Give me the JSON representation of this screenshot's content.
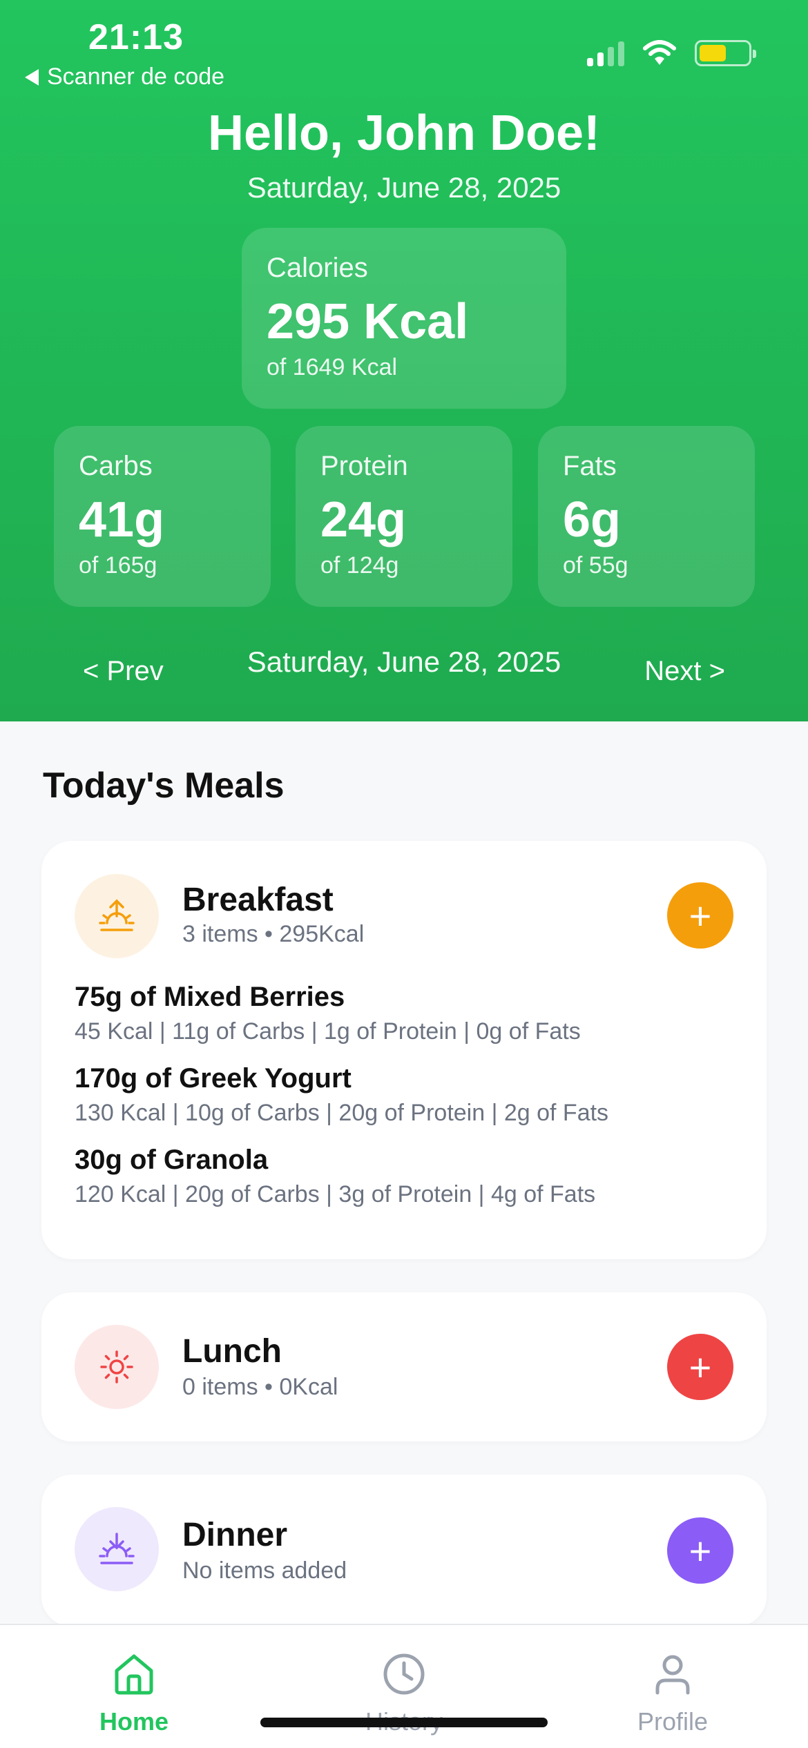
{
  "status_bar": {
    "time": "21:13",
    "back_label": "Scanner de code"
  },
  "header": {
    "greeting": "Hello, John Doe!",
    "date": "Saturday, June 28, 2025"
  },
  "calories": {
    "label": "Calories",
    "value": "295 Kcal",
    "goal": "of 1649 Kcal"
  },
  "macros": [
    {
      "label": "Carbs",
      "value": "41g",
      "goal": "of 165g"
    },
    {
      "label": "Protein",
      "value": "24g",
      "goal": "of 124g"
    },
    {
      "label": "Fats",
      "value": "6g",
      "goal": "of 55g"
    }
  ],
  "day_nav": {
    "prev": "< Prev",
    "date": "Saturday, June 28, 2025",
    "next": "Next >"
  },
  "meals_section_title": "Today's Meals",
  "meals": [
    {
      "name": "Breakfast",
      "meta": "3 items • 295Kcal",
      "accent": "#f59e0b",
      "icon_bg": "#fdf2e2",
      "icon": "sunrise-icon",
      "items": [
        {
          "name": "75g of Mixed Berries",
          "details": "45 Kcal | 11g of Carbs | 1g of Protein | 0g of Fats"
        },
        {
          "name": "170g of Greek Yogurt",
          "details": "130 Kcal | 10g of Carbs | 20g of Protein | 2g of Fats"
        },
        {
          "name": "30g of Granola",
          "details": "120 Kcal | 20g of Carbs | 3g of Protein | 4g of Fats"
        }
      ]
    },
    {
      "name": "Lunch",
      "meta": "0 items • 0Kcal",
      "accent": "#ef4444",
      "icon_bg": "#fde8e8",
      "icon": "sun-icon",
      "items": []
    },
    {
      "name": "Dinner",
      "meta": "No items added",
      "accent": "#8b5cf6",
      "icon_bg": "#efe9fd",
      "icon": "sunset-icon",
      "items": []
    }
  ],
  "add_symbol": "+",
  "tabs": [
    {
      "label": "Home",
      "icon": "home-icon",
      "active": true
    },
    {
      "label": "History",
      "icon": "clock-icon",
      "active": false
    },
    {
      "label": "Profile",
      "icon": "user-icon",
      "active": false
    }
  ],
  "colors": {
    "header_green": "#22c55e",
    "active_tab": "#22c55e",
    "inactive_tab": "#9ca3af"
  }
}
